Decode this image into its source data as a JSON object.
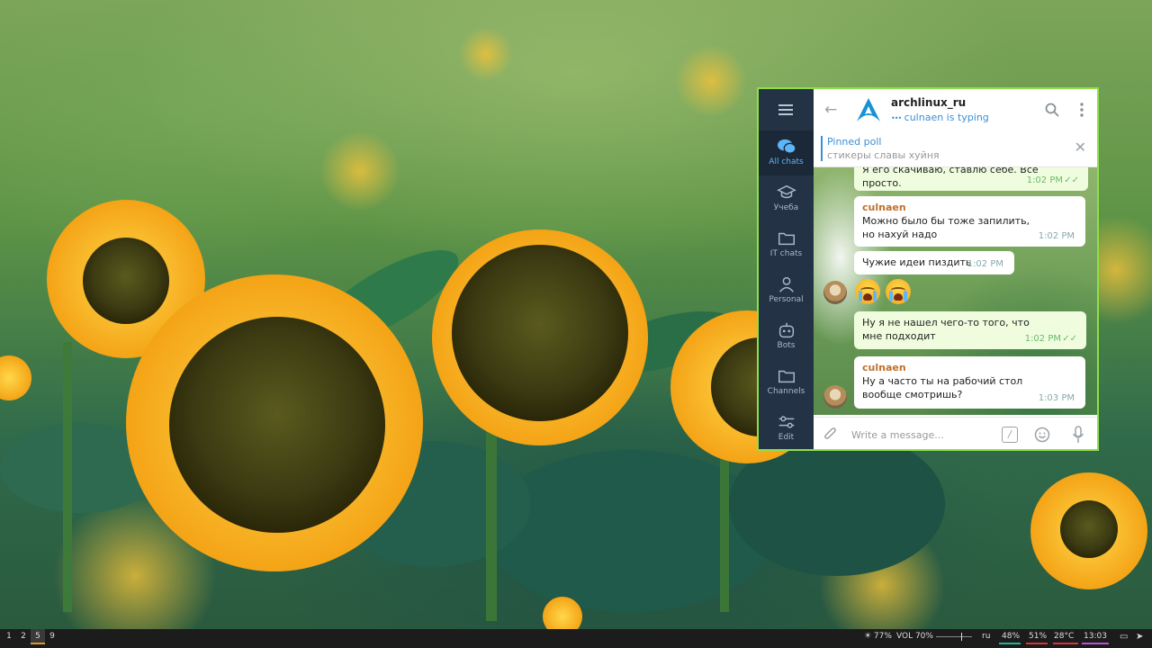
{
  "telegram": {
    "sidebar": {
      "items": [
        {
          "label": "All chats",
          "icon": "chats-icon",
          "active": true
        },
        {
          "label": "Учеба",
          "icon": "graduation-cap-icon"
        },
        {
          "label": "IT chats",
          "icon": "folder-icon"
        },
        {
          "label": "Personal",
          "icon": "person-icon"
        },
        {
          "label": "Bots",
          "icon": "bot-icon"
        },
        {
          "label": "Channels",
          "icon": "folder-icon"
        },
        {
          "label": "Edit",
          "icon": "sliders-icon"
        }
      ]
    },
    "header": {
      "title": "archlinux_ru",
      "status": "culnaen is typing",
      "typing_dots": "•••"
    },
    "pinned": {
      "title": "Pinned poll",
      "text": "стикеры славы хуйня"
    },
    "messages": [
      {
        "direction": "out",
        "text": "Я его скачиваю, ставлю себе. Все просто.",
        "time": "1:02 PM",
        "read": true
      },
      {
        "direction": "in",
        "sender": "culnaen",
        "text": "Можно было бы тоже запилить, но нахуй надо",
        "time": "1:02 PM"
      },
      {
        "direction": "in",
        "text": "Чужие идеи пиздить",
        "time": "1:02 PM"
      },
      {
        "direction": "in",
        "emoji": "😭😭"
      },
      {
        "direction": "out",
        "text": "Ну я не нашел чего-то того, что мне подходит",
        "time": "1:02 PM",
        "read": true
      },
      {
        "direction": "in",
        "sender": "culnaen",
        "text": "Ну а часто ты на рабочий стол вообще смотришь?",
        "time": "1:03 PM"
      }
    ],
    "composer": {
      "placeholder": "Write a message...",
      "commands_glyph": "/"
    },
    "accent_color": "#3a8fd6",
    "window_border_color": "#8ee04a"
  },
  "taskbar": {
    "workspaces": [
      "1",
      "2",
      "5",
      "9"
    ],
    "active_workspace": "5",
    "brightness": "☀ 77%",
    "volume": "VOL 70%",
    "volume_level": 0.7,
    "keyboard_layout": "ru",
    "cpu": "48%",
    "memory": "51%",
    "temperature": "28°C",
    "clock": "13:03",
    "colors": {
      "cpu": "#27b09a",
      "memory": "#d8343a",
      "temperature": "#d8343a",
      "clock": "#c04fd8"
    }
  }
}
